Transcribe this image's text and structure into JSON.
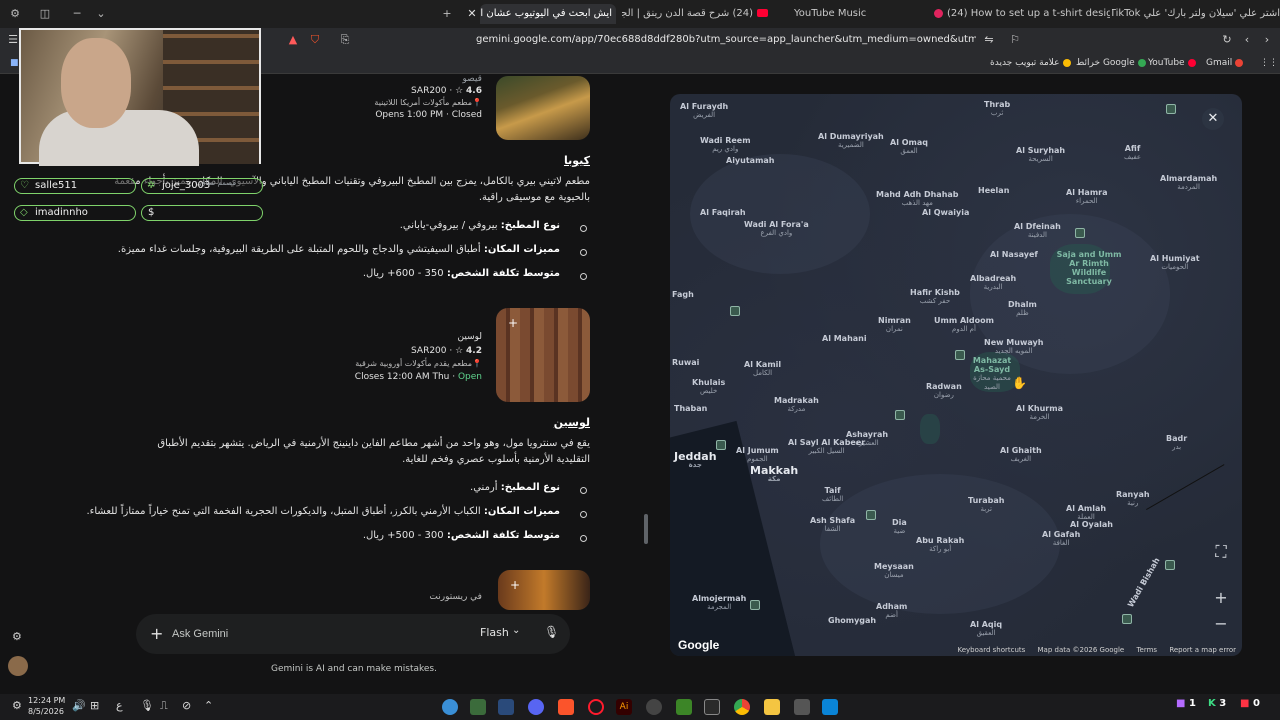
{
  "browser": {
    "tabs": [
      {
        "label": "اشتر علي 'سيلان ولتر بارك' علي TikTok",
        "active": false
      },
      {
        "label": "(24) How to set up a t-shirt design fi...",
        "active": false
      },
      {
        "label": "YouTube Music",
        "active": false
      },
      {
        "label": "(24) شرح قصة الدن رينق | الجزء الثالث",
        "active": false
      },
      {
        "label": "ايش ابحث في اليوتيوب عشان اجيب",
        "active": true
      }
    ],
    "new_tab_symbol": "+",
    "url": "gemini.google.com/app/70ec688d8ddf280b?utm_source=app_launcher&utm_medium=owned&utm_campaign=base_all",
    "bookmarks": [
      {
        "label": "Gmail",
        "color": "#ea4335"
      },
      {
        "label": "YouTube",
        "color": "#ff0033"
      },
      {
        "label": "خرائط Google",
        "color": "#34a853"
      },
      {
        "label": "علامة تبويب جديدة",
        "color": "#fbbc04"
      }
    ]
  },
  "stream_overlay": {
    "chat_users": [
      "salle511",
      "joje_3003",
      "imadinnho",
      "$"
    ],
    "overlay_label": "مصمم نطاق"
  },
  "chat": {
    "place1": {
      "name": "قيصو",
      "price": "SAR200",
      "rating": "4.6",
      "star": "☆",
      "category": "مطعم مأكولات أمريكا اللاتينية",
      "hours": "Opens 1:00 PM",
      "status": "Closed"
    },
    "section1": {
      "title": "كيوبا",
      "description": "مطعم لاتيني بيري بالكامل، يمزج بين المطبخ البيروفي وتقنيات المطبخ الياباني والآسيوي. المكان يتميز بأجواء مفعمة بالحيوية مع موسيقى راقية.",
      "bullets": [
        {
          "label": "نوع المطبخ:",
          "value": "بيروفي / بيروفي-ياباني."
        },
        {
          "label": "مميزات المكان:",
          "value": "أطباق السيفيتشي والدجاج واللحوم المتبلة على الطريقة البيروفية، وجلسات غداء مميزة."
        },
        {
          "label": "متوسط تكلفة الشخص:",
          "value": "350 - 600+ ريال."
        }
      ]
    },
    "place2": {
      "name": "لوسين",
      "price": "SAR200",
      "rating": "4.2",
      "star": "☆",
      "category": "مطعم يقدم مأكولات أوروبية شرقية",
      "hours": "Closes 12:00 AM Thu",
      "status": "Open"
    },
    "section2": {
      "title": "لوسين",
      "description": "يقع في سنترويا مول، وهو واحد من أشهر مطاعم الفاين داينينج الأرمنية في الرياض. يتشهر بتقديم الأطباق التقليدية الأرمنية بأسلوب عصري وفخم للغاية.",
      "bullets": [
        {
          "label": "نوع المطبخ:",
          "value": "أرمني."
        },
        {
          "label": "مميزات المكان:",
          "value": "الكباب الأرمني بالكرز، أطباق المتبل، والديكورات الحجرية الفخمة التي تمنح خياراً ممتازاً للعشاء."
        },
        {
          "label": "متوسط تكلفة الشخص:",
          "value": "300 - 500+ ريال."
        }
      ]
    },
    "place3": {
      "name": "في ريستورنت"
    },
    "input": {
      "placeholder": "Ask Gemini",
      "model": "Flash"
    },
    "disclaimer": "Gemini is AI and can make mistakes."
  },
  "map": {
    "cities": [
      {
        "name": "Al Furaydh",
        "ar": "الفريض"
      },
      {
        "name": "Thrab",
        "ar": "ثرب"
      },
      {
        "name": "Wadi Reem",
        "ar": "وادي ريم"
      },
      {
        "name": "Al Dumayriyah",
        "ar": "الضميرية"
      },
      {
        "name": "Al Omaq",
        "ar": "العمق"
      },
      {
        "name": "Al Suryhah",
        "ar": "السريحة"
      },
      {
        "name": "Afif",
        "ar": "عفيف"
      },
      {
        "name": "Aiyutamah",
        "ar": ""
      },
      {
        "name": "Mahd Adh Dhahab",
        "ar": "مهد الذهب"
      },
      {
        "name": "Heelan",
        "ar": ""
      },
      {
        "name": "Al Hamra",
        "ar": "الحمراء"
      },
      {
        "name": "Almardamah",
        "ar": "المردمة"
      },
      {
        "name": "Al Faqirah",
        "ar": ""
      },
      {
        "name": "Wadi Al Fora'a",
        "ar": "وادي الفرع"
      },
      {
        "name": "Al Qwaiyia",
        "ar": ""
      },
      {
        "name": "Al Dfeinah",
        "ar": "الدفينة"
      },
      {
        "name": "Saja and Umm Ar Rimth Wildlife Sanctuary",
        "ar": ""
      },
      {
        "name": "Al Humiyat",
        "ar": "الحوميات"
      },
      {
        "name": "Al Nasayef",
        "ar": ""
      },
      {
        "name": "Albadreah",
        "ar": "البدرية"
      },
      {
        "name": "Hafir Kishb",
        "ar": "حفر كشب"
      },
      {
        "name": "Dhalm",
        "ar": "ظلم"
      },
      {
        "name": "Nimran",
        "ar": "نمران"
      },
      {
        "name": "Umm Aldoom",
        "ar": "أم الدوم"
      },
      {
        "name": "Al Mahani",
        "ar": ""
      },
      {
        "name": "New Muwayh",
        "ar": "المويه الجديد"
      },
      {
        "name": "Mahazat As-Sayd",
        "ar": "محمية محازة الصيد"
      },
      {
        "name": "Al Kamil",
        "ar": "الكامل"
      },
      {
        "name": "Radwan",
        "ar": "رضوان"
      },
      {
        "name": "Khulais",
        "ar": "خليص"
      },
      {
        "name": "Madrakah",
        "ar": "مدركة"
      },
      {
        "name": "Al Khurma",
        "ar": "الخرمة"
      },
      {
        "name": "Ashayrah",
        "ar": "العشيرة"
      },
      {
        "name": "Al Ghaith",
        "ar": "الغريف"
      },
      {
        "name": "Al Sayl Al Kabeer",
        "ar": "السيل الكبير"
      },
      {
        "name": "Al Jumum",
        "ar": "الجموم"
      },
      {
        "name": "Jeddah",
        "ar": "جدة"
      },
      {
        "name": "Makkah",
        "ar": "مكة"
      },
      {
        "name": "Taif",
        "ar": "الطائف"
      },
      {
        "name": "Turabah",
        "ar": "تربة"
      },
      {
        "name": "Ranyah",
        "ar": "رنية"
      },
      {
        "name": "Ash Shafa",
        "ar": "الشفا"
      },
      {
        "name": "Dia",
        "ar": "ضية"
      },
      {
        "name": "Al Amlah",
        "ar": "العملة"
      },
      {
        "name": "Al Oyalah",
        "ar": ""
      },
      {
        "name": "Al Gafah",
        "ar": "الغافة"
      },
      {
        "name": "Abu Rakah",
        "ar": "أبو راكة"
      },
      {
        "name": "Meysaan",
        "ar": "ميسان"
      },
      {
        "name": "Almojermah",
        "ar": "المجرمة"
      },
      {
        "name": "Adham",
        "ar": "أضم"
      },
      {
        "name": "Ghomygah",
        "ar": ""
      },
      {
        "name": "Al Aqiq",
        "ar": "العقيق"
      },
      {
        "name": "Wadi Bishah",
        "ar": ""
      },
      {
        "name": "Badr",
        "ar": "بدر"
      },
      {
        "name": "Fagh",
        "ar": ""
      },
      {
        "name": "Ruwai",
        "ar": ""
      },
      {
        "name": "Thaban",
        "ar": ""
      }
    ],
    "logo": "Google",
    "attribution": [
      "Keyboard shortcuts",
      "Map data ©2026 Google",
      "Terms",
      "Report a map error"
    ]
  },
  "taskbar": {
    "time": "12:24 PM",
    "date": "8/5/2026",
    "counters": [
      "1",
      "3",
      "0"
    ]
  },
  "colors": {
    "background": "#131314",
    "map_bg": "#252b38",
    "open_status": "#5fd38d",
    "chat_border": "#7fd36b"
  }
}
